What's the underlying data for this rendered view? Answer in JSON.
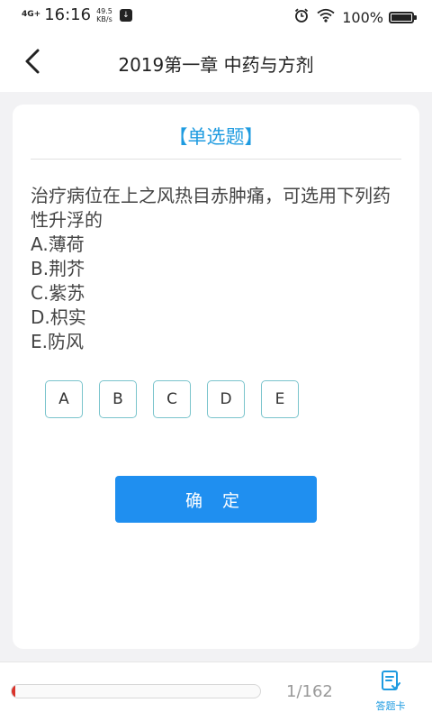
{
  "status_bar": {
    "network": "4G+",
    "time": "16:16",
    "speed_value": "49.5",
    "speed_unit": "KB/s",
    "notification_glyph": "↓",
    "battery_percent": "100%",
    "icons": [
      "alarm-icon",
      "wifi-icon",
      "battery-icon"
    ]
  },
  "header": {
    "title": "2019第一章 中药与方剂",
    "back_icon": "chevron-left-icon"
  },
  "question": {
    "type_label": "【单选题】",
    "stem": "治疗病位在上之风热目赤肿痛，可选用下列药性升浮的",
    "options": [
      "A.薄荷",
      "B.荆芥",
      "C.紫苏",
      "D.枳实",
      "E.防风"
    ]
  },
  "answers": [
    "A",
    "B",
    "C",
    "D",
    "E"
  ],
  "confirm_label": "确 定",
  "footer": {
    "progress": {
      "current": 1,
      "total": 162,
      "label": "1/162"
    },
    "answer_card_label": "答题卡",
    "answer_card_icon": "answer-sheet-icon"
  },
  "colors": {
    "accent": "#1e9be0",
    "button": "#1f8ff0",
    "progress_fill": "#d9342b",
    "option_border": "#7ac4cc"
  }
}
